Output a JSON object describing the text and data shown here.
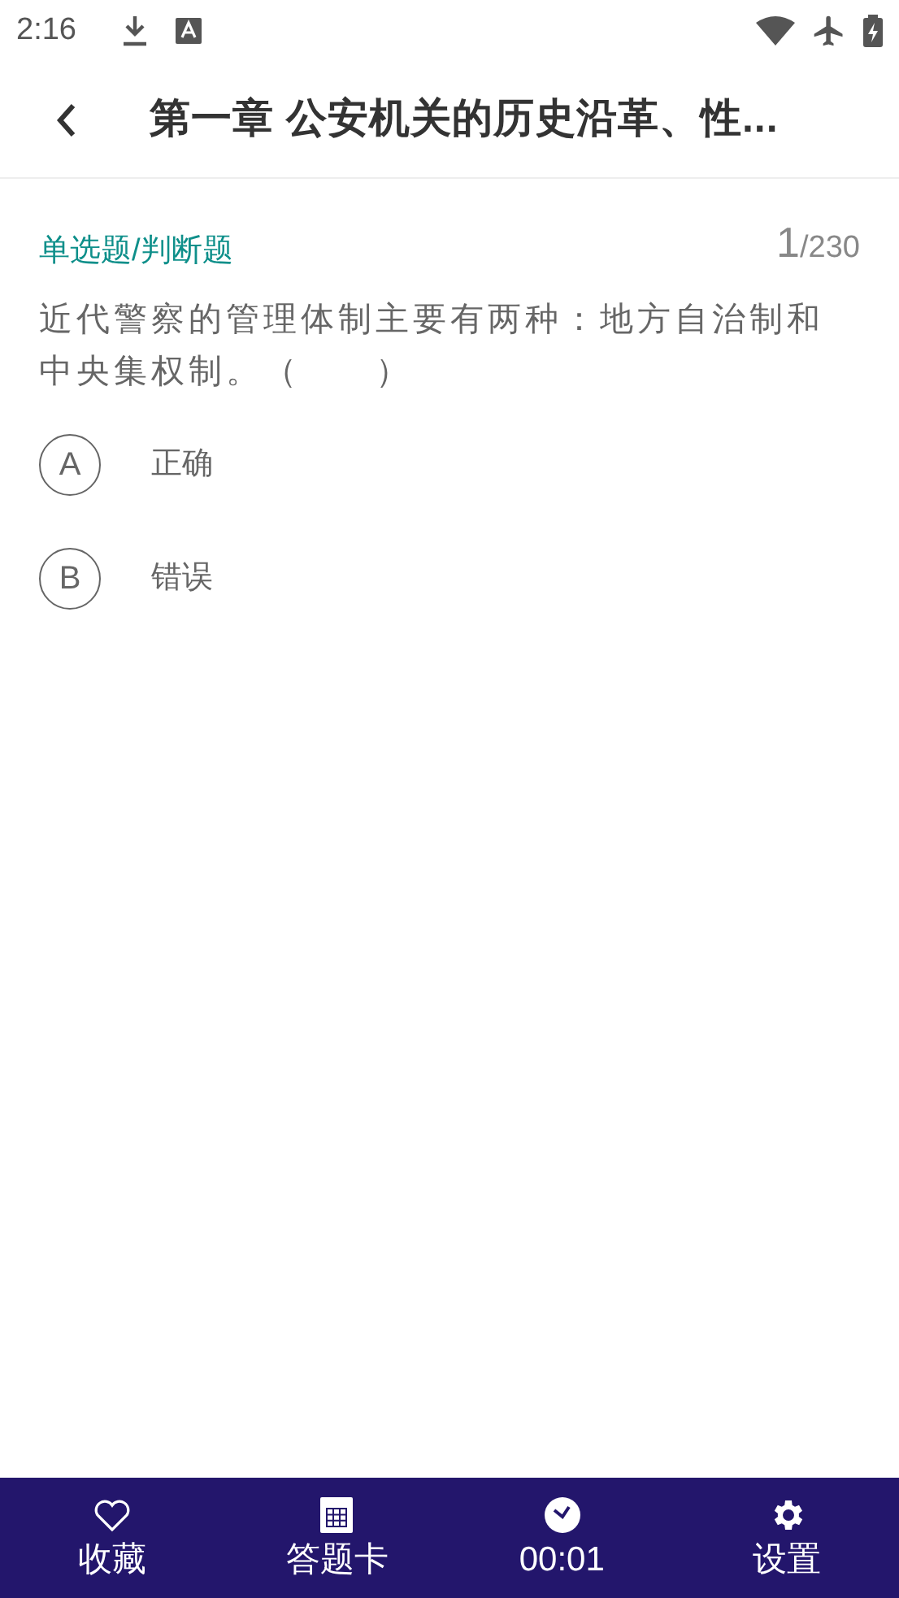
{
  "status_bar": {
    "time": "2:16"
  },
  "header": {
    "title": "第一章 公安机关的历史沿革、性..."
  },
  "question": {
    "type": "单选题/判断题",
    "number": "1",
    "total": "/230",
    "text": "近代警察的管理体制主要有两种：地方自治制和中央集权制。（　　）",
    "options": [
      {
        "letter": "A",
        "text": "正确",
        "selected": false
      },
      {
        "letter": "B",
        "text": "错误",
        "selected": false
      }
    ]
  },
  "bottom_bar": {
    "items": [
      {
        "kind": "favorite",
        "label": "收藏"
      },
      {
        "kind": "card",
        "label": "答题卡"
      },
      {
        "kind": "timer",
        "label": "00:01"
      },
      {
        "kind": "settings",
        "label": "设置"
      }
    ]
  }
}
